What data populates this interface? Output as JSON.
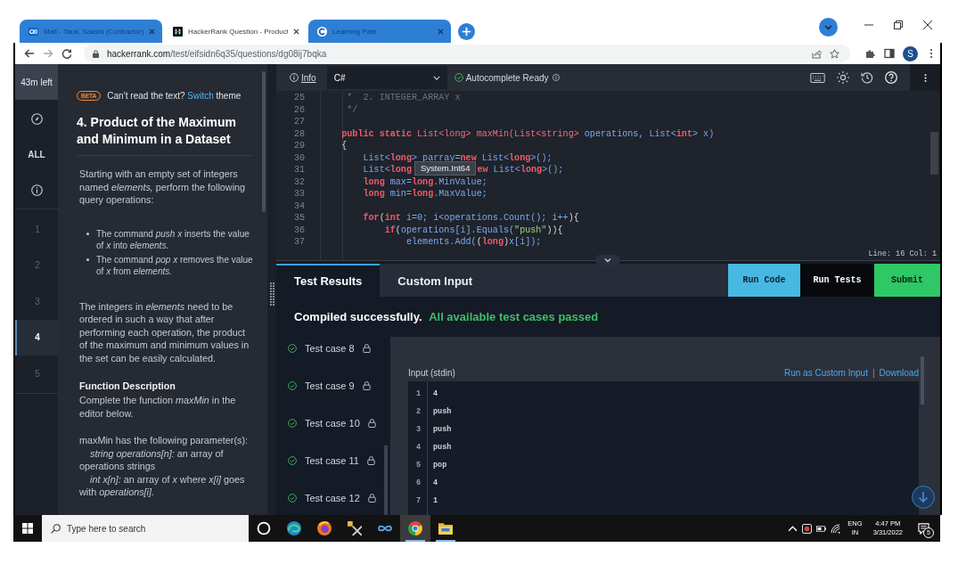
{
  "browser": {
    "tabs": [
      {
        "title": "Mail - Taral, Sakshi (Contractor)",
        "kind": "mail",
        "selected": false
      },
      {
        "title": "HackerRank Question - Product",
        "kind": "code",
        "selected": true
      },
      {
        "title": "Learning Path",
        "kind": "learning",
        "selected": false
      }
    ],
    "url_host": "hackerrank.com",
    "url_path": "/test/eifsidn6q35/questions/dg08ij7bqka",
    "profile_initial": "S"
  },
  "nav": {
    "timer": "43m left",
    "all_label": "ALL",
    "questions": [
      {
        "label": "1",
        "selected": false
      },
      {
        "label": "2",
        "selected": false
      },
      {
        "label": "3",
        "selected": false
      },
      {
        "label": "4",
        "selected": true
      },
      {
        "label": "5",
        "selected": false
      }
    ]
  },
  "problem": {
    "beta_badge": "BETA",
    "theme_prompt": "Can’t read the text?",
    "theme_link": "Switch",
    "theme_suffix": "theme",
    "title": "4. Product of the Maximum and Minimum in a Dataset",
    "intro": "Starting with an empty set of integers named *elements,* perform the following query operations:",
    "bullets": [
      "The command *push x* inserts the value of *x* into *elements.*",
      "The command *pop x* removes the value of *x* from *elements.*"
    ],
    "paragraph": "The integers in *elements* need to be ordered in such a way that after performing each operation, the product of the maximum and minimum values in the set can be easily calculated.",
    "function_heading": "Function Description",
    "function_text": "Complete the function *maxMin* in the editor below.",
    "params_intro": "maxMin has the following parameter(s):",
    "params": [
      "*string operations[n]:*  an array of operations strings",
      "*int x[n]:*  an array of *x* where *x[i]* goes with *operations[i].*"
    ]
  },
  "editor": {
    "info_link": "Info",
    "language": "C#",
    "autocomplete_status": "Autocomplete Ready",
    "lines": [
      {
        "number": "25",
        "tokens": [
          {
            "kind": "comment",
            "text": "     *  2. INTEGER_ARRAY x"
          }
        ]
      },
      {
        "number": "26",
        "tokens": [
          {
            "kind": "comment",
            "text": "     */"
          }
        ]
      },
      {
        "number": "27"
      },
      {
        "number": "28",
        "tokens": [
          {
            "kind": "keyword",
            "text": "    public static "
          },
          {
            "kind": "name",
            "text": "List<long> maxMin(List<string> "
          },
          {
            "kind": "ident",
            "text": "operations, "
          },
          {
            "kind": "type",
            "text": "List<"
          },
          {
            "kind": "keyword",
            "text": "int"
          },
          {
            "kind": "type",
            "text": "> x)"
          }
        ]
      },
      {
        "number": "29",
        "tokens": [
          {
            "kind": "punct",
            "text": "    {"
          }
        ]
      },
      {
        "number": "30",
        "tokens": [
          {
            "kind": "type",
            "text": "        List<"
          },
          {
            "kind": "keyword",
            "text": "long"
          },
          {
            "kind": "type",
            "text": "> "
          },
          {
            "kind": "ident",
            "text": "parray="
          },
          {
            "kind": "keyword",
            "text": "new "
          },
          {
            "kind": "type",
            "text": "List<"
          },
          {
            "kind": "keyword",
            "text": "long"
          },
          {
            "kind": "type",
            "text": ">();"
          }
        ]
      },
      {
        "number": "31",
        "tokens": [
          {
            "kind": "type",
            "text": "        List<"
          },
          {
            "kind": "keyword",
            "text": "long"
          }
        ],
        "hover_tooltip": "System.Int64",
        "tokens_after_tooltip": [
          {
            "kind": "keyword",
            "text": "ew "
          },
          {
            "kind": "type",
            "text": "List<"
          },
          {
            "kind": "keyword",
            "text": "long"
          },
          {
            "kind": "type",
            "text": ">();"
          }
        ]
      },
      {
        "number": "32",
        "tokens": [
          {
            "kind": "keyword",
            "text": "        long "
          },
          {
            "kind": "ident",
            "text": "max="
          },
          {
            "kind": "keyword",
            "text": "long"
          },
          {
            "kind": "ident",
            "text": ".MinValue;"
          }
        ]
      },
      {
        "number": "33",
        "tokens": [
          {
            "kind": "keyword",
            "text": "        long "
          },
          {
            "kind": "ident",
            "text": "min="
          },
          {
            "kind": "keyword",
            "text": "long"
          },
          {
            "kind": "ident",
            "text": ".MaxValue;"
          }
        ]
      },
      {
        "number": "34"
      },
      {
        "number": "35",
        "tokens": [
          {
            "kind": "keyword",
            "text": "        for"
          },
          {
            "kind": "punct",
            "text": "("
          },
          {
            "kind": "keyword",
            "text": "int "
          },
          {
            "kind": "ident",
            "text": "i=0; i<operations.Count(); i++"
          },
          {
            "kind": "punct",
            "text": "){"
          }
        ]
      },
      {
        "number": "36",
        "tokens": [
          {
            "kind": "keyword",
            "text": "            if"
          },
          {
            "kind": "punct",
            "text": "("
          },
          {
            "kind": "ident",
            "text": "operations[i].Equals("
          },
          {
            "kind": "string",
            "text": "\"push\""
          },
          {
            "kind": "punct",
            "text": ")){"
          }
        ]
      },
      {
        "number": "37",
        "tokens": [
          {
            "kind": "ident",
            "text": "                elements.Add("
          },
          {
            "kind": "punct",
            "text": "("
          },
          {
            "kind": "keyword",
            "text": "long"
          },
          {
            "kind": "punct",
            "text": ")"
          },
          {
            "kind": "ident",
            "text": "x[i]);"
          }
        ]
      }
    ],
    "cursor_position": "Line: 16 Col: 1"
  },
  "results": {
    "tabs": [
      {
        "label": "Test Results",
        "selected": true
      },
      {
        "label": "Custom Input",
        "selected": false
      }
    ],
    "actions": [
      {
        "label": "Run Code",
        "kind": "run"
      },
      {
        "label": "Run Tests",
        "kind": "tests"
      },
      {
        "label": "Submit",
        "kind": "submit"
      }
    ],
    "status": "Compiled successfully.",
    "status_detail": "All available test cases passed",
    "test_cases": [
      {
        "label": "Test case 8",
        "passed": true,
        "locked": true
      },
      {
        "label": "Test case 9",
        "passed": true,
        "locked": true
      },
      {
        "label": "Test case 10",
        "passed": true,
        "locked": true
      },
      {
        "label": "Test case 11",
        "passed": true,
        "locked": true
      },
      {
        "label": "Test case 12",
        "passed": true,
        "locked": true
      }
    ],
    "input_label": "Input (stdin)",
    "links": [
      "Run as Custom Input",
      "Download"
    ],
    "link_separator": "|",
    "input_lines": [
      {
        "number": "1",
        "text": "4"
      },
      {
        "number": "2",
        "text": "push"
      },
      {
        "number": "3",
        "text": "push"
      },
      {
        "number": "4",
        "text": "push"
      },
      {
        "number": "5",
        "text": "pop"
      },
      {
        "number": "6",
        "text": "4"
      },
      {
        "number": "7",
        "text": "1"
      }
    ]
  },
  "taskbar": {
    "search_placeholder": "Type here to search",
    "apps": [
      {
        "kind": "ring",
        "selected": false,
        "running": false
      },
      {
        "kind": "swirl",
        "selected": false,
        "running": false
      },
      {
        "kind": "flame",
        "selected": false,
        "running": false
      },
      {
        "kind": "tools",
        "selected": false,
        "running": false
      },
      {
        "kind": "loop",
        "selected": false,
        "running": false
      },
      {
        "kind": "browser",
        "selected": true,
        "running": true
      },
      {
        "kind": "folder",
        "selected": false,
        "running": true
      }
    ],
    "language": "ENG",
    "region": "IN",
    "time": "4:47 PM",
    "date": "3/31/2022",
    "notification_count": "5"
  }
}
